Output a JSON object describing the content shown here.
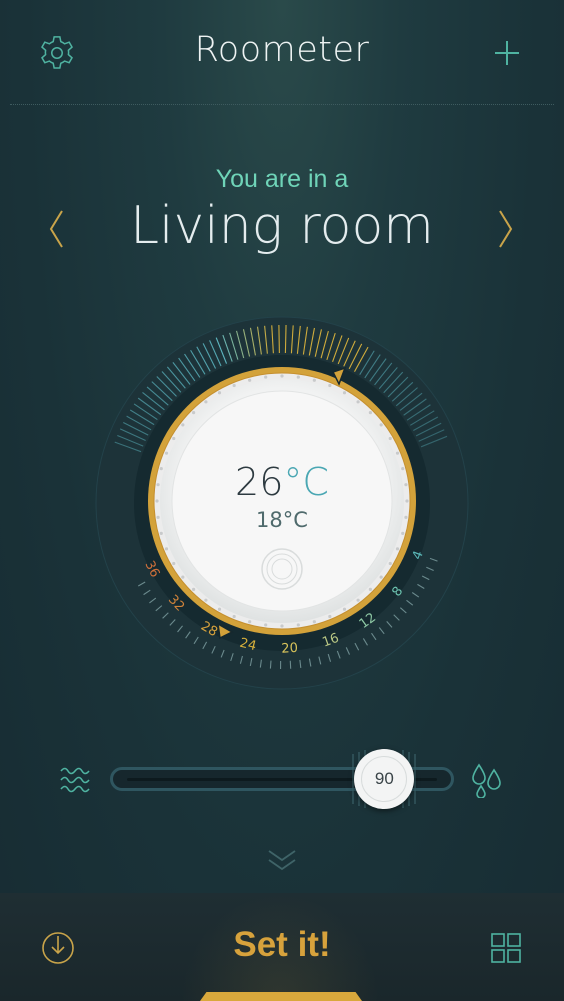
{
  "app": {
    "title": "Roometer",
    "settings_icon": "gear-icon",
    "add_icon": "plus-icon"
  },
  "location": {
    "prefix": "You are in a",
    "room": "Living room",
    "prev_icon": "chevron-left-icon",
    "next_icon": "chevron-right-icon"
  },
  "thermostat": {
    "target_temp": "26",
    "target_unit": "°C",
    "current_temp": "18",
    "current_unit": "°C",
    "scale_labels": [
      "36",
      "32",
      "28",
      "24",
      "20",
      "16",
      "12",
      "8",
      "4"
    ]
  },
  "humidity": {
    "value": "90",
    "level_percent": 82,
    "low_icon": "waves-icon",
    "high_icon": "water-drops-icon"
  },
  "footer": {
    "expand_icon": "double-chevron-down-icon",
    "download_icon": "download-icon",
    "action_label": "Set it!",
    "menu_icon": "grid-icon"
  },
  "colors": {
    "accent_gold": "#d7a23c",
    "accent_teal": "#6fd4b8",
    "background": "#1a3238"
  }
}
